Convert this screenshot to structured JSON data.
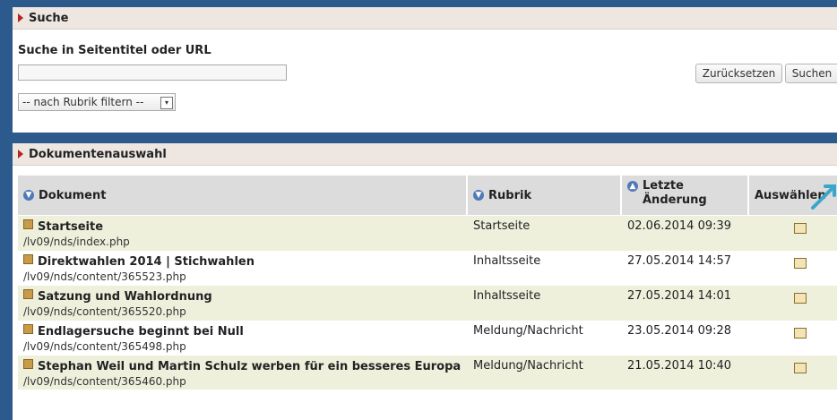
{
  "search": {
    "header": "Suche",
    "title": "Suche in Seitentitel oder URL",
    "input_value": "",
    "reset_label": "Zurücksetzen",
    "search_label": "Suchen",
    "filter_selected": "-- nach Rubrik filtern --"
  },
  "docs": {
    "header": "Dokumentenauswahl",
    "columns": {
      "document": "Dokument",
      "category": "Rubrik",
      "changed": "Letzte Änderung",
      "select": "Auswählen"
    },
    "rows": [
      {
        "title": "Startseite",
        "path": "/lv09/nds/index.php",
        "category": "Startseite",
        "date": "02.06.2014 09:39"
      },
      {
        "title": "Direktwahlen 2014 | Stichwahlen",
        "path": "/lv09/nds/content/365523.php",
        "category": "Inhaltsseite",
        "date": "27.05.2014 14:57"
      },
      {
        "title": "Satzung und Wahlordnung",
        "path": "/lv09/nds/content/365520.php",
        "category": "Inhaltsseite",
        "date": "27.05.2014 14:01"
      },
      {
        "title": "Endlagersuche beginnt bei Null",
        "path": "/lv09/nds/content/365498.php",
        "category": "Meldung/Nachricht",
        "date": "23.05.2014 09:28"
      },
      {
        "title": "Stephan Weil und Martin Schulz werben für ein besseres Europa",
        "path": "/lv09/nds/content/365460.php",
        "category": "Meldung/Nachricht",
        "date": "21.05.2014 10:40"
      }
    ]
  },
  "colors": {
    "frame": "#2c5a8c",
    "header_bg": "#ede6e1",
    "row_alt": "#eef0dc",
    "accent_red": "#b3261e",
    "pointer": "#3aa6c9"
  }
}
